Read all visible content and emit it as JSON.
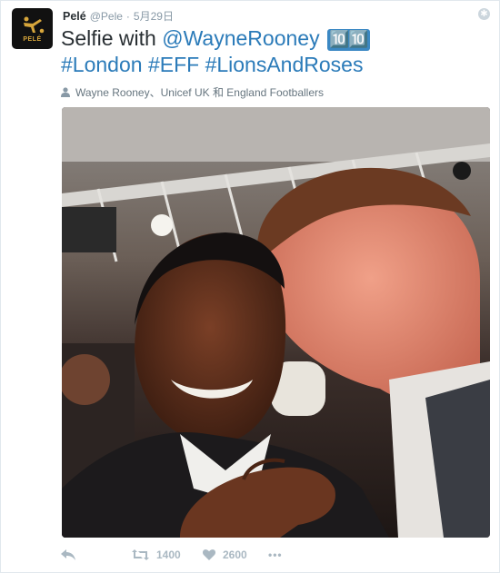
{
  "tweet": {
    "author_name": "Pelé",
    "author_handle": "@Pele",
    "separator": "·",
    "date": "5月29日",
    "avatar_text": "PELÉ",
    "text_prefix": "Selfie with ",
    "mention": "@WayneRooney",
    "emoji": "🔟🔟",
    "hashtags": [
      "#London",
      "#EFF",
      "#LionsAndRoses"
    ],
    "tagged": "Wayne Rooney、Unicef UK 和 England Footballers"
  },
  "actions": {
    "retweets": "1400",
    "likes": "2600",
    "more": "•••"
  },
  "colors": {
    "link": "#2b7bb9",
    "muted": "#8899a6",
    "icon": "#aab8c2"
  },
  "icons": {
    "reply": "reply-icon",
    "retweet": "retweet-icon",
    "like": "heart-icon",
    "more": "more-icon",
    "settings": "gear-icon",
    "tagged": "person-icon"
  }
}
